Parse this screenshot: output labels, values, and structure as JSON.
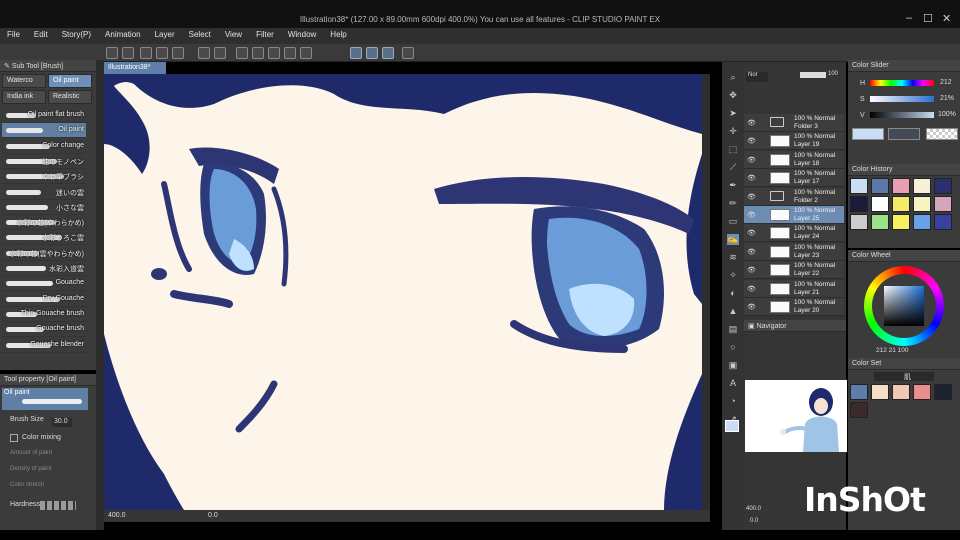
{
  "window": {
    "title": "Illustration38* (127.00 x 89.00mm 600dpi 400.0%)  You can use all features - CLIP STUDIO PAINT EX",
    "min": "–",
    "max": "☐",
    "close": "✕"
  },
  "menu": [
    "File",
    "Edit",
    "Story(P)",
    "Animation",
    "Layer",
    "Select",
    "View",
    "Filter",
    "Window",
    "Help"
  ],
  "canvas_tab": "Illustration38*",
  "sub_tool": {
    "header": "Sub Tool [Brush]",
    "tabs": [
      "Waterco",
      "Oil paint",
      "India ink",
      "Realistic"
    ],
    "selected_tab": "Oil paint",
    "brushes": [
      "Oil paint flat brush",
      "Oil paint",
      "Color change",
      "油のモノペン",
      "やわ筆ブラシ",
      "迷いの雲",
      "小さな雲",
      "水彩の芯(やわらかめ)",
      "水彩うろこ雲",
      "水彩の芯(雲やわらかめ)",
      "水彩入道雲",
      "Gouache",
      "Dry Gouache",
      "Thin Gouache brush",
      "Gouache brush",
      "Gouache blender"
    ],
    "selected_brush": "Oil paint"
  },
  "tool_property": {
    "header": "Tool property [Oil paint]",
    "preset": "Oil paint",
    "brush_size_label": "Brush Size",
    "brush_size": "30.0",
    "color_mixing_label": "Color mixing",
    "amount_label": "Amount of paint",
    "density_label": "Density of paint",
    "stretch_label": "Color stretch",
    "hardness_label": "Hardness"
  },
  "status": {
    "zoom": "400.0",
    "rotate": "0.0"
  },
  "layers": {
    "blend_mode": "Nor",
    "opacity": "100",
    "rows": [
      {
        "line1": "100 % Normal",
        "line2": "Folder 3",
        "type": "folder"
      },
      {
        "line1": "100 % Normal",
        "line2": "Layer 19",
        "type": "layer"
      },
      {
        "line1": "100 % Normal",
        "line2": "Layer 18",
        "type": "layer"
      },
      {
        "line1": "100 % Normal",
        "line2": "Layer 17",
        "type": "layer"
      },
      {
        "line1": "100 % Normal",
        "line2": "Folder 2",
        "type": "folder"
      },
      {
        "line1": "100 % Normal",
        "line2": "Layer 25",
        "type": "layer"
      },
      {
        "line1": "100 % Normal",
        "line2": "Layer 24",
        "type": "layer"
      },
      {
        "line1": "100 % Normal",
        "line2": "Layer 23",
        "type": "layer"
      },
      {
        "line1": "100 % Normal",
        "line2": "Layer 22",
        "type": "layer"
      },
      {
        "line1": "100 % Normal",
        "line2": "Layer 21",
        "type": "layer"
      },
      {
        "line1": "100 % Normal",
        "line2": "Layer 20",
        "type": "layer"
      }
    ],
    "selected": "Layer 25"
  },
  "navigator": {
    "header": "Navigator",
    "zoom": "400.0",
    "rotate": "0.0"
  },
  "color_slider": {
    "header": "Color Slider",
    "h_label": "H",
    "h": "212",
    "s_label": "S",
    "s": "21%",
    "v_label": "V",
    "v": "100%"
  },
  "color_history": {
    "header": "Color History",
    "colors": [
      "#c9ddf5",
      "#5a77a8",
      "#e8a0b0",
      "#f6f0d8",
      "#2a2f6e",
      "#1a1d3a",
      "#ffffff",
      "#f5e96a",
      "#f8f4c0",
      "#d4a6b8",
      "#ccc",
      "#9ce08a",
      "#f8f060",
      "#6aa0e6",
      "#3a3fa0"
    ]
  },
  "color_wheel": {
    "header": "Color Wheel",
    "readout": "212  21  100"
  },
  "color_set": {
    "header": "Color Set",
    "set_name": "肌",
    "colors": [
      "#5b7fa8",
      "#f6dfc7",
      "#f3c7b5",
      "#eb8f8e",
      "#1f2230",
      "#3a2a28"
    ]
  },
  "watermark": "InShOt",
  "colors": {
    "canvas_bg": "#fdf4ea",
    "hair": "#1f2a6b",
    "eye": "#5a8fd0",
    "accent": "#6d8fb8"
  }
}
